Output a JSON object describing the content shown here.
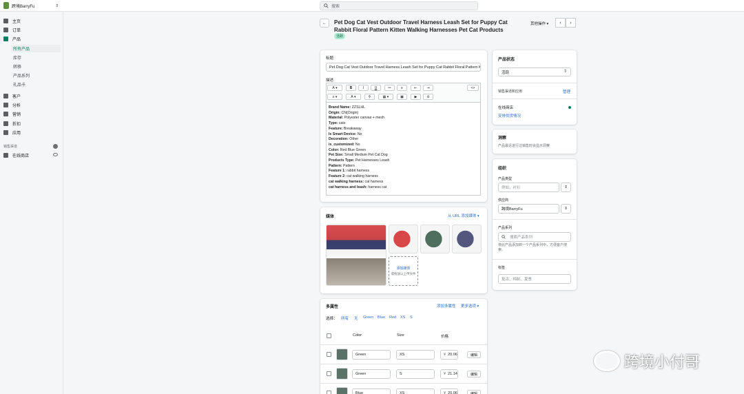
{
  "topbar": {
    "store_name": "跨境BarryFu",
    "search_placeholder": "搜索"
  },
  "sidebar": {
    "items": [
      {
        "label": "主页",
        "icon": "home-icon"
      },
      {
        "label": "订单",
        "icon": "orders-icon"
      },
      {
        "label": "产品",
        "icon": "tag-icon"
      },
      {
        "label": "客户",
        "icon": "person-icon"
      },
      {
        "label": "分析",
        "icon": "analytics-icon"
      },
      {
        "label": "营销",
        "icon": "megaphone-icon"
      },
      {
        "label": "折扣",
        "icon": "discount-icon"
      },
      {
        "label": "应用",
        "icon": "apps-icon"
      }
    ],
    "product_sub": [
      "所有产品",
      "库存",
      "转移",
      "产品系列",
      "礼品卡"
    ],
    "channels_heading": "销售渠道",
    "online_store": "在线商店"
  },
  "header": {
    "title": "Pet Dog Cat Vest Outdoor Travel Harness Leash Set for Puppy Cat Rabbit Floral Pattern Kitten Walking Harnesses Pet Cat Products",
    "status_badge": "活跃",
    "more_actions": "其他操作"
  },
  "title_card": {
    "title_label": "标题",
    "title_value": "Pet Dog Cat Vest Outdoor Travel Harness Leash Set for Puppy Cat Rabbit Floral Pattern Ki",
    "desc_label": "描述",
    "toolbar": {
      "font": "A",
      "bold": "B",
      "italic": "I",
      "underline": "U",
      "code": "<>",
      "align": "≡",
      "color": "A"
    }
  },
  "description": [
    {
      "k": "Brand Name",
      "v": "ZZSLHL"
    },
    {
      "k": "Origin",
      "v": "CN(Origin)"
    },
    {
      "k": "Material",
      "v": "Polyester canvas + mesh"
    },
    {
      "k": "Type",
      "v": "cats"
    },
    {
      "k": "Feature",
      "v": "Breakaway"
    },
    {
      "k": "Is Smart Device",
      "v": "No"
    },
    {
      "k": "Decoration",
      "v": "Other"
    },
    {
      "k": "is_customized",
      "v": "No"
    },
    {
      "k": "Color",
      "v": "Red Blue Green"
    },
    {
      "k": "Pet Size",
      "v": "Small Medium Pet Cat Dog"
    },
    {
      "k": "Products Type",
      "v": "Pet Harnesses Leash"
    },
    {
      "k": "Pattern",
      "v": "Pattern"
    },
    {
      "k": "Feature 1",
      "v": "rabbit harness"
    },
    {
      "k": "Feature 2",
      "v": "cat walking harness"
    },
    {
      "k": "cat walking harness",
      "v": "cat harness"
    },
    {
      "k": "cat harness and leash",
      "v": "harness cat"
    }
  ],
  "media": {
    "heading": "媒体",
    "add_from_url": "从 URL 添加媒体",
    "add_media": "添加媒体",
    "drag_hint": "或拖放以上传文件"
  },
  "variants": {
    "heading": "多属性",
    "add_variant": "添加多属性",
    "more_options": "更多选项",
    "select_label": "选择：",
    "filters": [
      "所有",
      "无",
      "Green",
      "Blue",
      "Red",
      "XS",
      "S"
    ],
    "col_color": "Color",
    "col_size": "Size",
    "col_price": "价格",
    "edit_label": "编辑",
    "rows": [
      {
        "color": "Green",
        "size": "XS",
        "price": "20.06"
      },
      {
        "color": "Green",
        "size": "S",
        "price": "21.14"
      },
      {
        "color": "Blue",
        "size": "XS",
        "price": "20.06"
      }
    ],
    "currency": "¥"
  },
  "status_card": {
    "heading": "产品状态",
    "status_value": "活跃",
    "channels_label": "销售渠道和应用",
    "manage": "管理",
    "online_store": "在线商店",
    "schedule": "安排供货情况"
  },
  "insights": {
    "heading": "洞察",
    "text": "产品最近进行过销售时会显示洞察"
  },
  "organization": {
    "heading": "组织",
    "type_label": "产品类型",
    "type_placeholder": "例如，衬衫",
    "vendor_label": "供应商",
    "vendor_value": "跨境BarryFu",
    "collections_label": "产品系列",
    "collections_placeholder": "搜索产品系列",
    "collections_hint": "将此产品添加到一个产品系列中，方便客户搜索。",
    "tags_label": "标签",
    "tags_placeholder": "复古、棉制、夏季"
  },
  "watermark": "跨境小付哥"
}
